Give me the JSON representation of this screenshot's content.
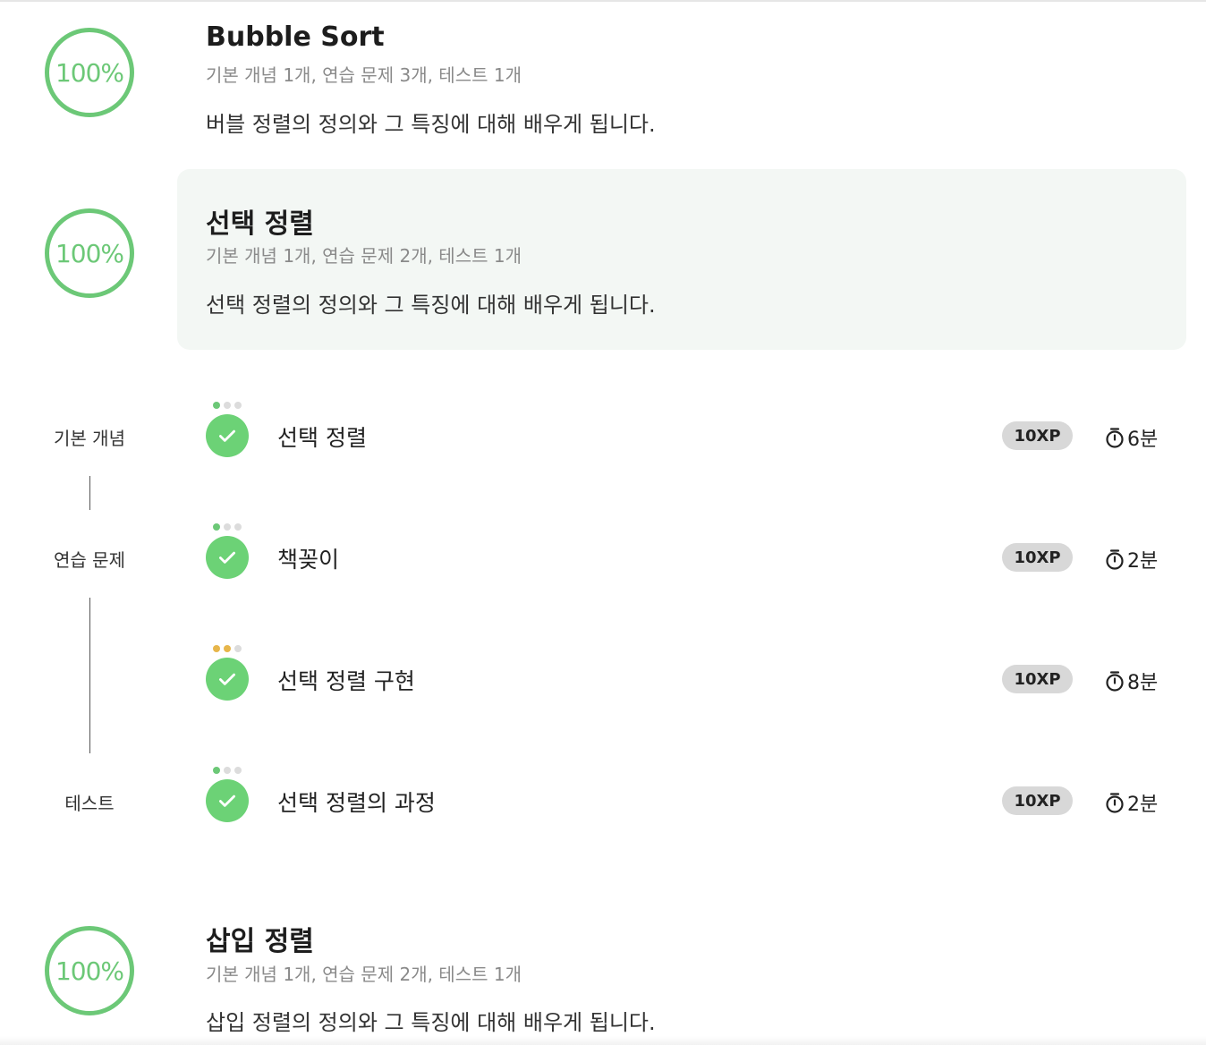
{
  "courses": [
    {
      "progress": "100%",
      "title": "Bubble Sort",
      "meta": "기본 개념 1개, 연습 문제 3개, 테스트 1개",
      "desc": "버블 정렬의 정의와 그 특징에 대해 배우게 됩니다."
    },
    {
      "progress": "100%",
      "title": "선택 정렬",
      "meta": "기본 개념 1개, 연습 문제 2개, 테스트 1개",
      "desc": "선택 정렬의 정의와 그 특징에 대해 배우게 됩니다.",
      "expanded": true
    },
    {
      "progress": "100%",
      "title": "삽입 정렬",
      "meta": "기본 개념 1개, 연습 문제 2개, 테스트 1개",
      "desc": "삽입 정렬의 정의와 그 특징에 대해 배우게 됩니다."
    }
  ],
  "stages": [
    "기본 개념",
    "연습 문제",
    "테스트"
  ],
  "lessons": [
    {
      "title": "선택 정렬",
      "xp": "10XP",
      "time": "6분",
      "difficulty": 1,
      "dot_color": "#6cc877"
    },
    {
      "title": "책꽂이",
      "xp": "10XP",
      "time": "2분",
      "difficulty": 1,
      "dot_color": "#6cc877"
    },
    {
      "title": "선택 정렬 구현",
      "xp": "10XP",
      "time": "8분",
      "difficulty": 2,
      "dot_color": "#e7b64b"
    },
    {
      "title": "선택 정렬의 과정",
      "xp": "10XP",
      "time": "2분",
      "difficulty": 1,
      "dot_color": "#6cc877"
    }
  ],
  "icons": {
    "complete": "check-circle-icon",
    "time": "stopwatch-icon"
  },
  "colors": {
    "accent": "#6cc877",
    "active_card_bg": "#f3f7f4",
    "xp_badge_bg": "#d8d8d8"
  }
}
